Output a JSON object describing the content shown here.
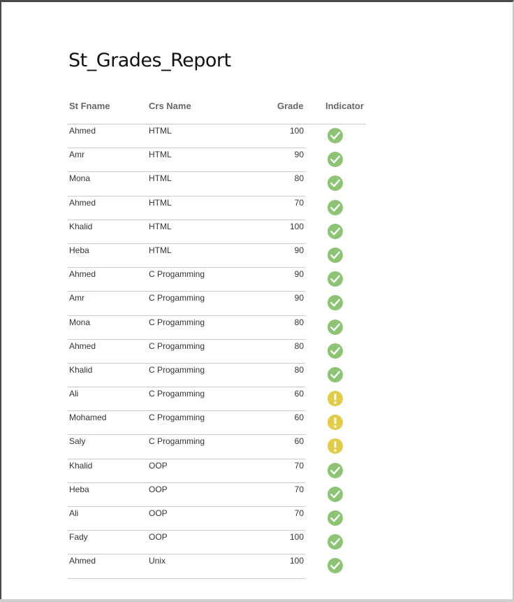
{
  "report": {
    "title": "St_Grades_Report",
    "columns": {
      "fname": "St Fname",
      "course": "Crs Name",
      "grade": "Grade",
      "indicator": "Indicator"
    },
    "colors": {
      "ok": "#8cc474",
      "warning": "#e2cb46"
    },
    "rows": [
      {
        "fname": "Ahmed",
        "course": "HTML",
        "grade": "100",
        "indicator": "check-icon"
      },
      {
        "fname": "Amr",
        "course": "HTML",
        "grade": "90",
        "indicator": "check-icon"
      },
      {
        "fname": "Mona",
        "course": "HTML",
        "grade": "80",
        "indicator": "check-icon"
      },
      {
        "fname": "Ahmed",
        "course": "HTML",
        "grade": "70",
        "indicator": "check-icon"
      },
      {
        "fname": "Khalid",
        "course": "HTML",
        "grade": "100",
        "indicator": "check-icon"
      },
      {
        "fname": "Heba",
        "course": "HTML",
        "grade": "90",
        "indicator": "check-icon"
      },
      {
        "fname": "Ahmed",
        "course": "C Progamming",
        "grade": "90",
        "indicator": "check-icon"
      },
      {
        "fname": "Amr",
        "course": "C Progamming",
        "grade": "90",
        "indicator": "check-icon"
      },
      {
        "fname": "Mona",
        "course": "C Progamming",
        "grade": "80",
        "indicator": "check-icon"
      },
      {
        "fname": "Ahmed",
        "course": "C Progamming",
        "grade": "80",
        "indicator": "check-icon"
      },
      {
        "fname": "Khalid",
        "course": "C Progamming",
        "grade": "80",
        "indicator": "check-icon"
      },
      {
        "fname": "Ali",
        "course": "C Progamming",
        "grade": "60",
        "indicator": "warning-icon"
      },
      {
        "fname": "Mohamed",
        "course": "C Progamming",
        "grade": "60",
        "indicator": "warning-icon"
      },
      {
        "fname": "Saly",
        "course": "C Progamming",
        "grade": "60",
        "indicator": "warning-icon"
      },
      {
        "fname": "Khalid",
        "course": "OOP",
        "grade": "70",
        "indicator": "check-icon"
      },
      {
        "fname": "Heba",
        "course": "OOP",
        "grade": "70",
        "indicator": "check-icon"
      },
      {
        "fname": "Ali",
        "course": "OOP",
        "grade": "70",
        "indicator": "check-icon"
      },
      {
        "fname": "Fady",
        "course": "OOP",
        "grade": "100",
        "indicator": "check-icon"
      },
      {
        "fname": "Ahmed",
        "course": "Unix",
        "grade": "100",
        "indicator": "check-icon"
      }
    ]
  }
}
